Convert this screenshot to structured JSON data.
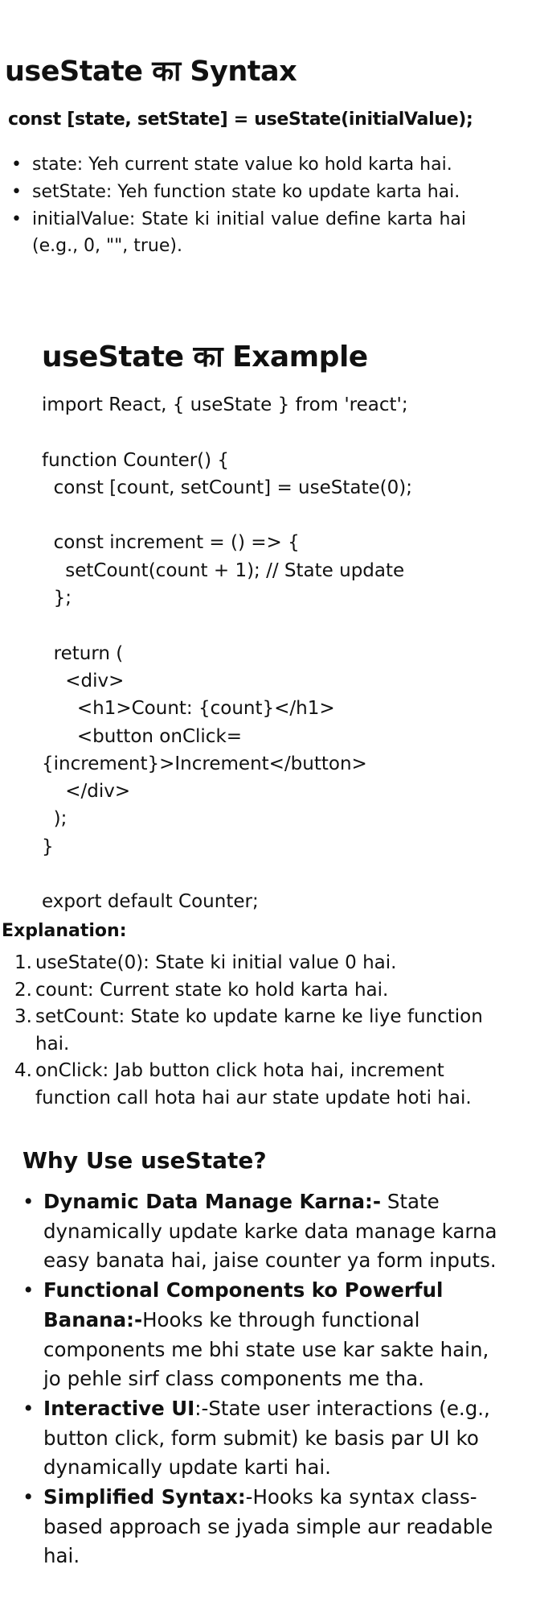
{
  "syntax": {
    "title": "useState का Syntax",
    "code": "const [state, setState] = useState(initialValue);",
    "items": [
      "state: Yeh current state value ko hold karta hai.",
      "setState: Yeh function state ko update karta hai.",
      "initialValue: State ki initial value define karta hai (e.g., 0, \"\", true)."
    ]
  },
  "example": {
    "title": "useState का Example",
    "code": "import React, { useState } from 'react';\n\nfunction Counter() {\n  const [count, setCount] = useState(0);\n\n  const increment = () => {\n    setCount(count + 1); // State update\n  };\n\n  return (\n    <div>\n      <h1>Count: {count}</h1>\n      <button onClick=\n{increment}>Increment</button>\n    </div>\n  );\n}\n\nexport default Counter;"
  },
  "explanation": {
    "heading": "Explanation:",
    "items": [
      {
        "num": "1.",
        "text": "useState(0): State ki initial value 0 hai."
      },
      {
        "num": "2.",
        "text": "count: Current state ko hold karta hai."
      },
      {
        "num": "3.",
        "text": "setCount: State ko update karne ke liye function hai."
      },
      {
        "num": "4.",
        "text": "onClick: Jab button click hota hai, increment function call hota hai aur state update hoti hai."
      }
    ]
  },
  "why": {
    "title": "Why Use useState?",
    "items": [
      {
        "bold": "Dynamic Data Manage Karna:-",
        "text": " State dynamically update karke data manage karna easy banata hai, jaise counter ya form inputs."
      },
      {
        "bold": "Functional Components ko Powerful Banana:-",
        "text": "Hooks ke through functional components me bhi state use kar sakte hain, jo pehle sirf class components me tha."
      },
      {
        "bold": "Interactive UI",
        "text": ":-State user interactions (e.g., button click, form submit) ke basis par UI ko dynamically update karti hai."
      },
      {
        "bold": "Simplified Syntax:",
        "text": "-Hooks ka syntax class-based approach se jyada simple aur readable hai."
      }
    ]
  }
}
